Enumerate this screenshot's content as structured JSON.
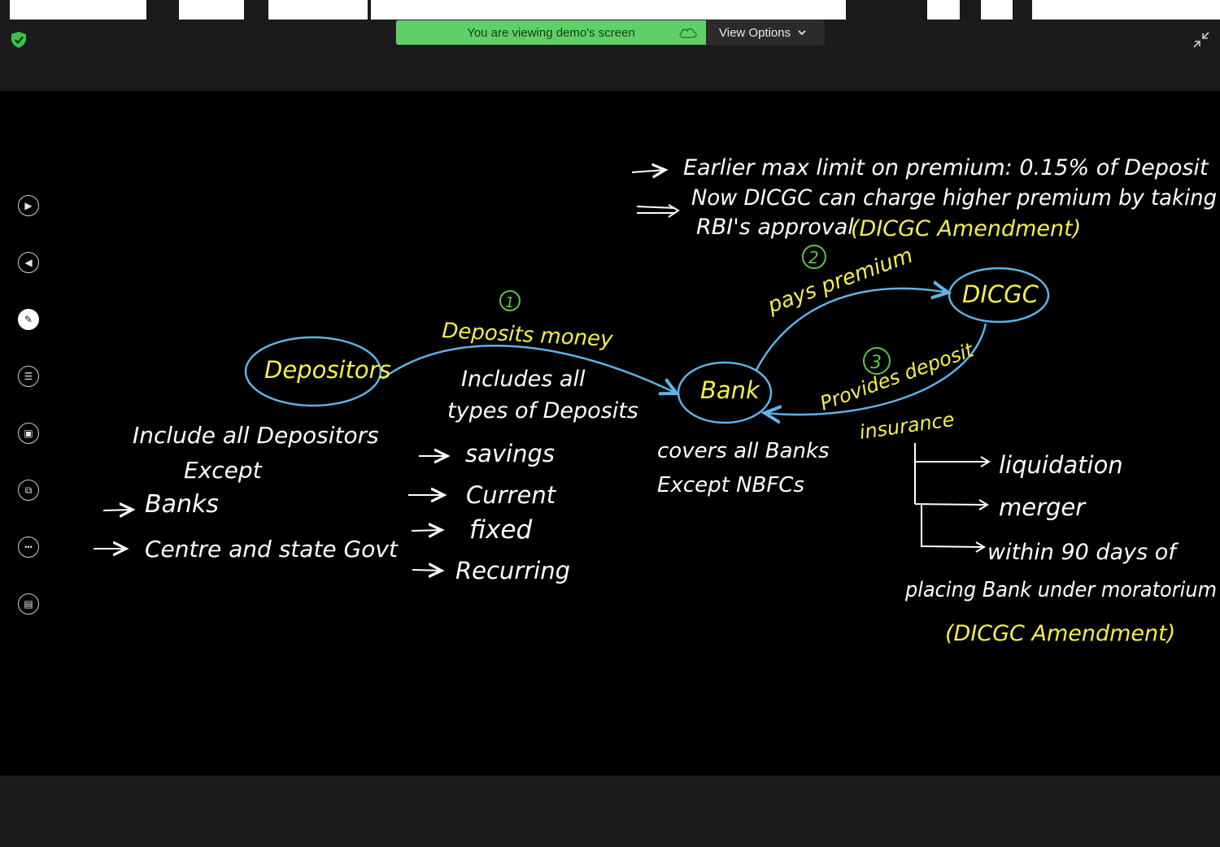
{
  "banner": {
    "message": "You are viewing demo's screen",
    "view_options": "View Options",
    "color": "#5fd068"
  },
  "icons": {
    "shield": "shield-check-icon",
    "collapse": "collapse-arrows-icon",
    "cloud": "cloud-icon",
    "chevron": "chevron-down-icon"
  },
  "toolbar": {
    "items": [
      {
        "name": "play-icon",
        "glyph": "▶"
      },
      {
        "name": "back-icon",
        "glyph": "◀"
      },
      {
        "name": "pen-icon",
        "glyph": "✎"
      },
      {
        "name": "notes-icon",
        "glyph": "☰"
      },
      {
        "name": "camera-icon",
        "glyph": "▣"
      },
      {
        "name": "share-screen-icon",
        "glyph": "⧉"
      },
      {
        "name": "more-icon",
        "glyph": "•••"
      },
      {
        "name": "presentation-icon",
        "glyph": "▤"
      }
    ]
  },
  "board": {
    "colors": {
      "ink_white": "#ffffff",
      "ink_yellow": "#f5ef48",
      "ink_blue": "#5fb3e8",
      "ink_green": "#5ec24a"
    },
    "nodes": {
      "depositors": "Depositors",
      "bank": "Bank",
      "dicgc": "DICGC"
    },
    "steps": {
      "one": "1",
      "two": "2",
      "three": "3"
    },
    "edges": {
      "deposits_money": "Deposits money",
      "pays_premium": "pays premium",
      "provides_deposit": "Provides deposit",
      "insurance": "insurance"
    },
    "premium_notes": {
      "line1": "Earlier max limit on premium: 0.15% of Deposit",
      "line2": "Now DICGC can charge higher premium by taking",
      "line3": "RBI's approval",
      "line3_amend": "(DICGC Amendment)"
    },
    "depositors_notes": {
      "line1": "Include all Depositors",
      "line2": "Except",
      "item1": "Banks",
      "item2": "Centre and state Govt"
    },
    "deposit_types": {
      "line1": "Includes all",
      "line2": "types of Deposits",
      "items": [
        "savings",
        "Current",
        "fixed",
        "Recurring"
      ]
    },
    "bank_notes": {
      "line1": "covers all Banks",
      "line2": "Except NBFCs"
    },
    "insurance_notes": {
      "item1": "liquidation",
      "item2": "merger",
      "item3": "within 90 days of",
      "item3b": "placing Bank under moratorium",
      "amend": "(DICGC Amendment)"
    }
  }
}
